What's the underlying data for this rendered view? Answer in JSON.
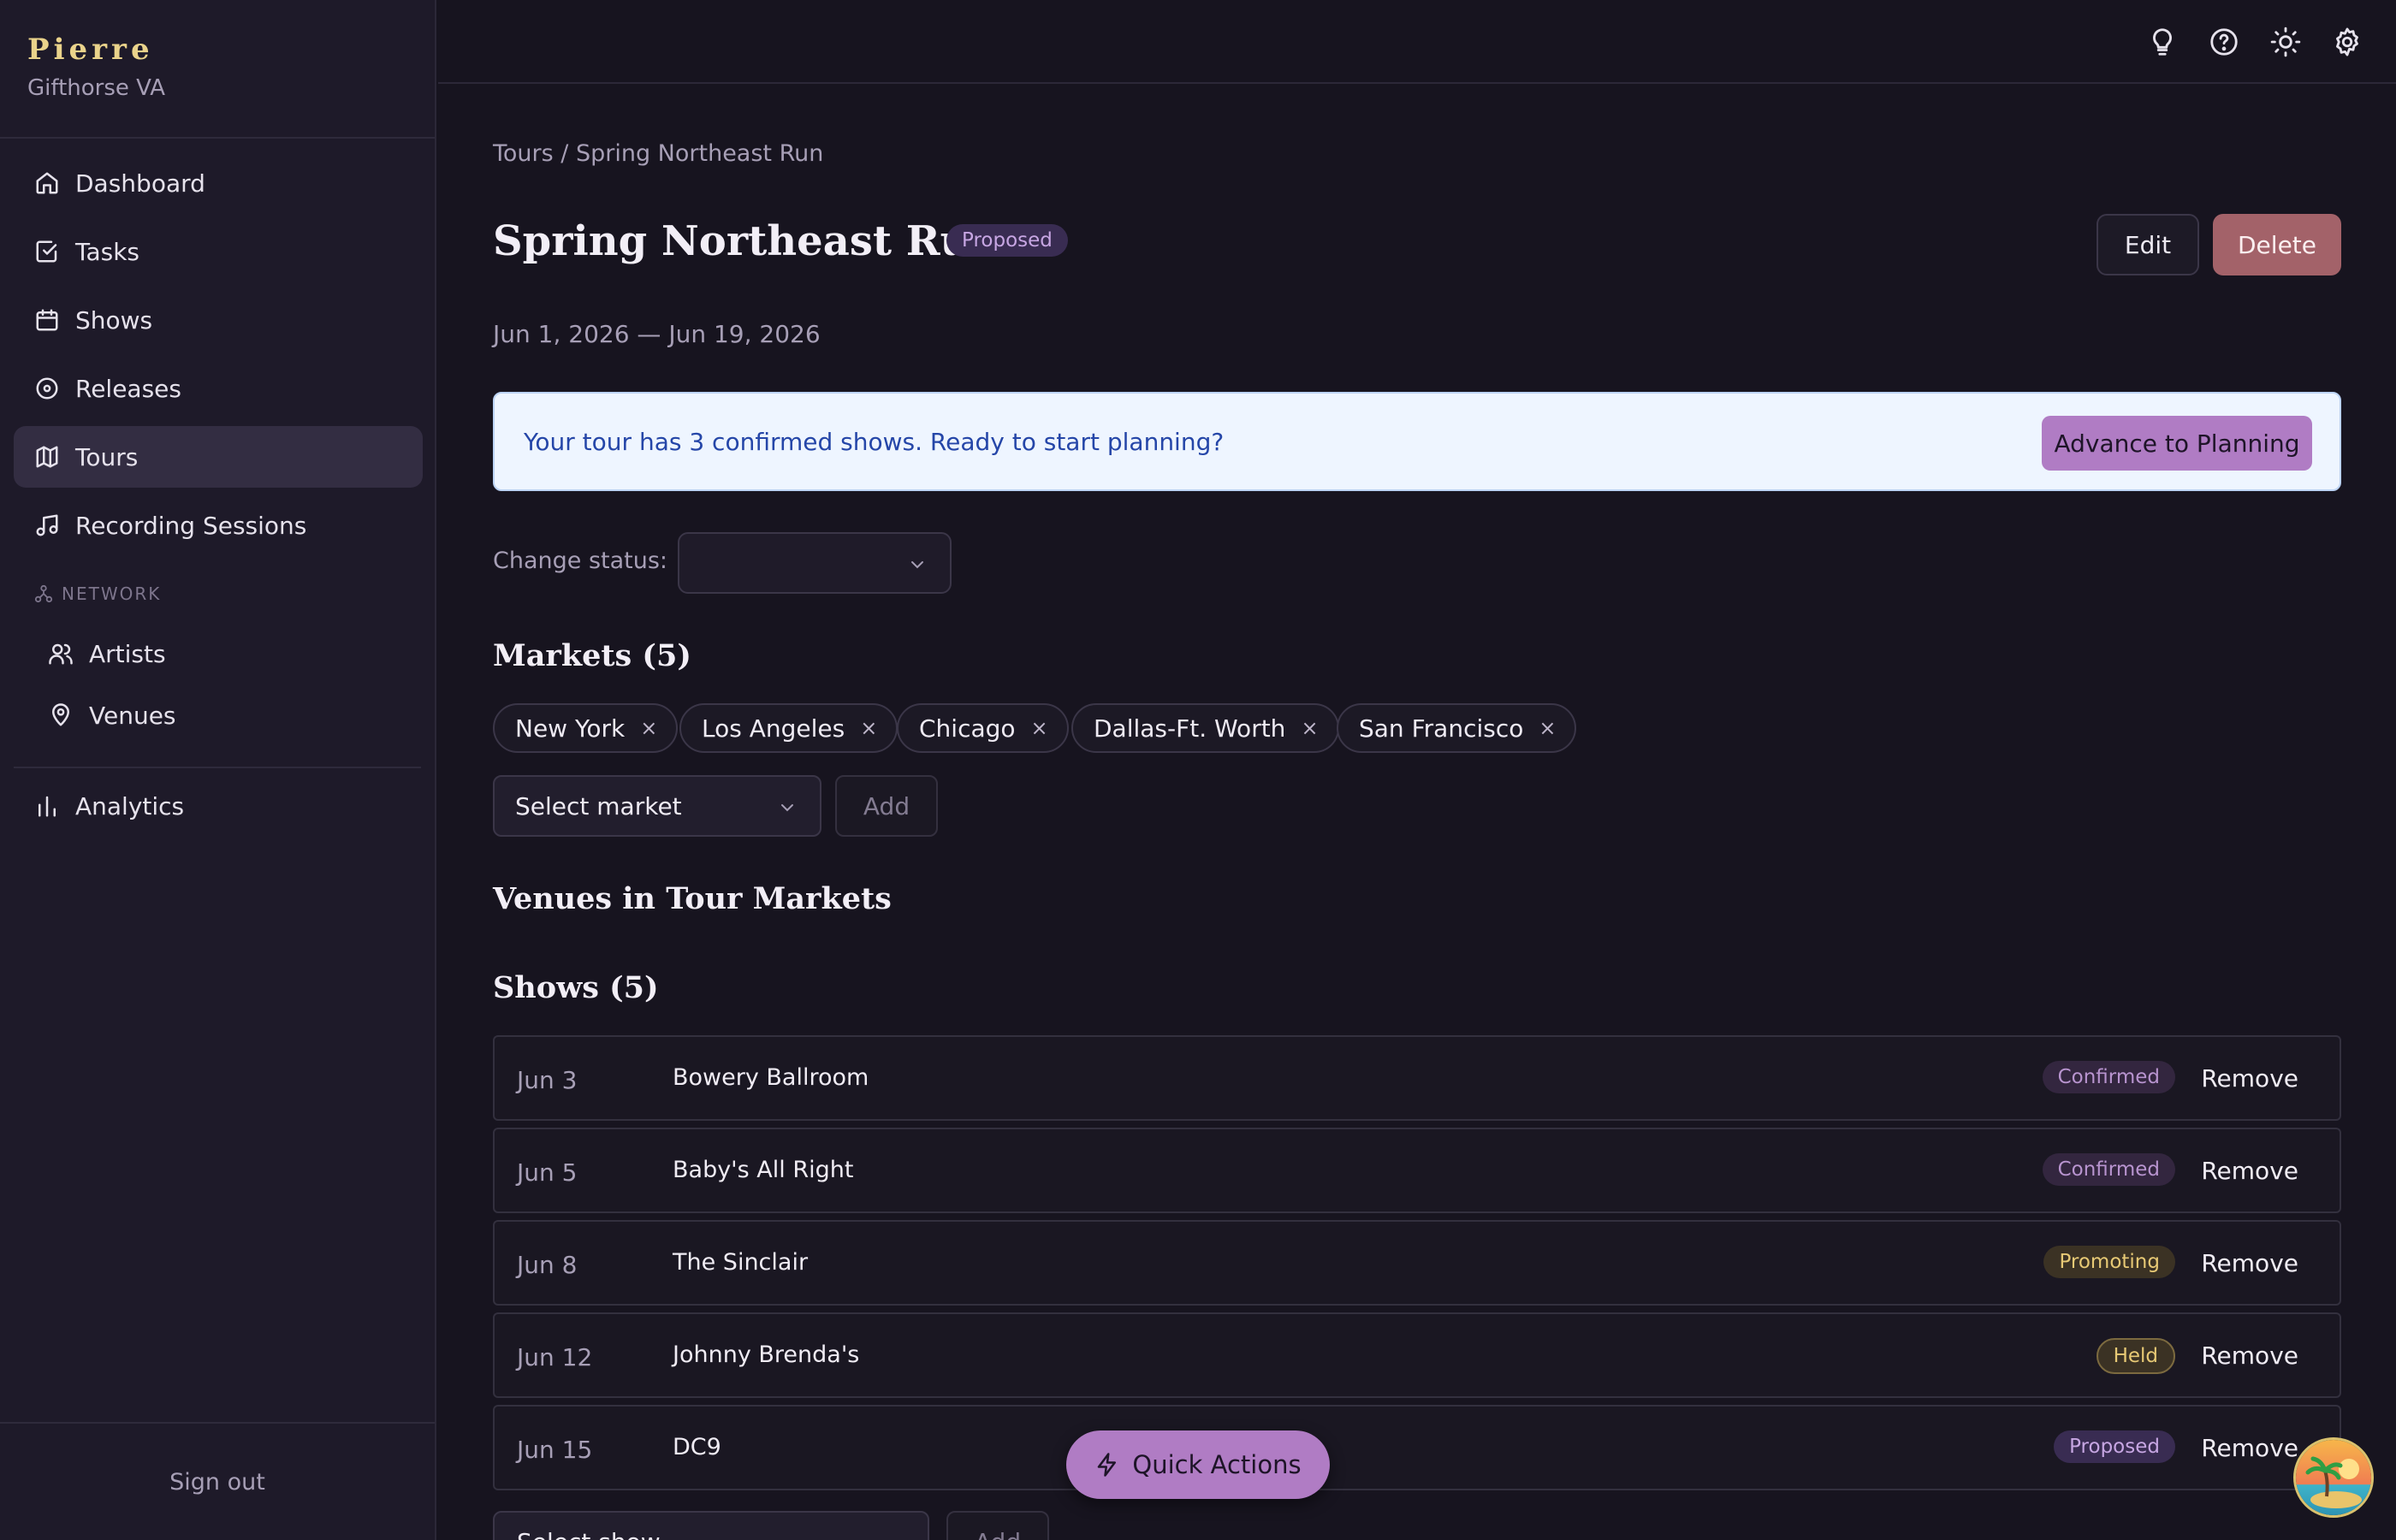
{
  "brand": {
    "name": "Pierre",
    "subtitle": "Gifthorse VA"
  },
  "sidebar": {
    "items": [
      {
        "label": "Dashboard",
        "icon": "home-icon"
      },
      {
        "label": "Tasks",
        "icon": "check-square-icon"
      },
      {
        "label": "Shows",
        "icon": "calendar-icon"
      },
      {
        "label": "Releases",
        "icon": "disc-icon"
      },
      {
        "label": "Tours",
        "icon": "map-icon",
        "active": true
      },
      {
        "label": "Recording Sessions",
        "icon": "music-note-icon"
      }
    ],
    "network_section": "NETWORK",
    "network_items": [
      {
        "label": "Artists",
        "icon": "users-icon"
      },
      {
        "label": "Venues",
        "icon": "map-pin-icon"
      }
    ],
    "analytics": {
      "label": "Analytics",
      "icon": "bar-chart-icon"
    },
    "sign_out": "Sign out"
  },
  "topbar": {
    "icons": [
      "lightbulb-icon",
      "help-icon",
      "sun-icon",
      "gear-icon"
    ]
  },
  "breadcrumb": "Tours / Spring Northeast Run",
  "tour": {
    "title": "Spring Northeast Run",
    "status_badge": "Proposed",
    "date_range": "Jun 1, 2026 — Jun 19, 2026"
  },
  "actions": {
    "edit": "Edit",
    "delete": "Delete"
  },
  "banner": {
    "text": "Your tour has 3 confirmed shows. Ready to start planning?",
    "button": "Advance to Planning"
  },
  "status_change": {
    "label": "Change status:",
    "value": ""
  },
  "markets": {
    "heading": "Markets (5)",
    "items": [
      "New York",
      "Los Angeles",
      "Chicago",
      "Dallas-Ft. Worth",
      "San Francisco"
    ],
    "remove_glyph": "×",
    "select_placeholder": "Select market",
    "add_label": "Add"
  },
  "venues_heading": "Venues in Tour Markets",
  "shows": {
    "heading": "Shows (5)",
    "remove_label": "Remove",
    "rows": [
      {
        "date": "Jun 3",
        "venue": "Bowery Ballroom",
        "status": "Confirmed"
      },
      {
        "date": "Jun 5",
        "venue": "Baby's All Right",
        "status": "Confirmed"
      },
      {
        "date": "Jun 8",
        "venue": "The Sinclair",
        "status": "Promoting"
      },
      {
        "date": "Jun 12",
        "venue": "Johnny Brenda's",
        "status": "Held"
      },
      {
        "date": "Jun 15",
        "venue": "DC9",
        "status": "Proposed"
      }
    ],
    "select_placeholder": "Select show",
    "add_label": "Add"
  },
  "quick_actions": "Quick Actions",
  "colors": {
    "background": "#17141f",
    "sidebar": "#1e1a29",
    "accent": "#b07cc4",
    "brand": "#ead38b",
    "danger": "#a36269",
    "banner_bg": "#eef5ff",
    "banner_text": "#2546a8"
  }
}
